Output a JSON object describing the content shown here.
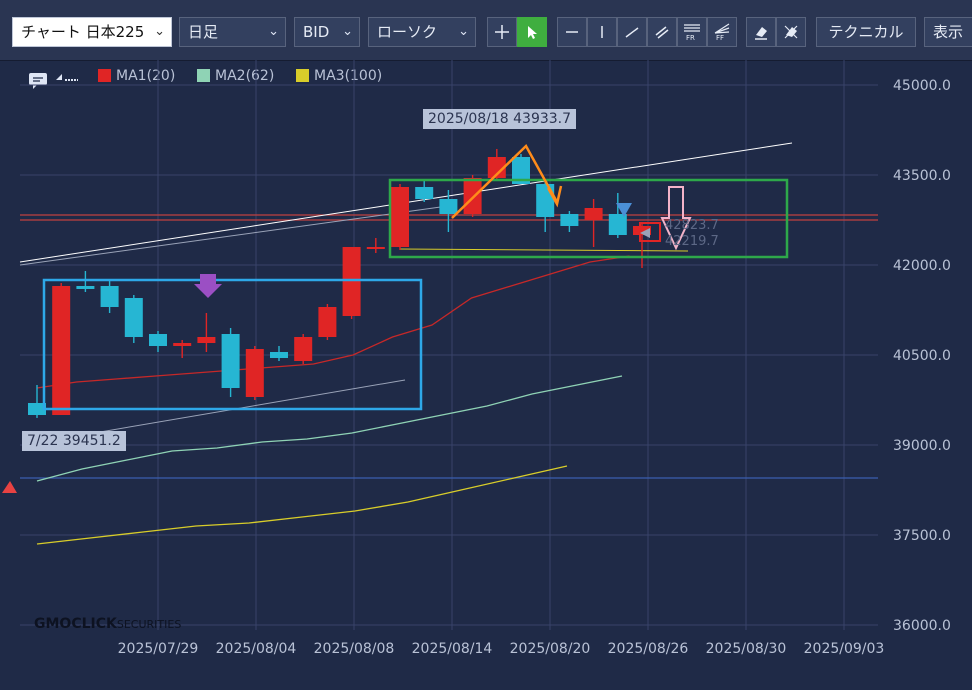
{
  "toolbar": {
    "symbol": "チャート 日本225",
    "timeframe": "日足",
    "price_type": "BID",
    "chart_style": "ローソク",
    "technical_label": "テクニカル",
    "display_label": "表示",
    "fr_label": "FR",
    "ff_label": "FF"
  },
  "legend": {
    "ma1": "MA1(20)",
    "ma2": "MA2(62)",
    "ma3": "MA3(100)"
  },
  "colors": {
    "ma1": "#c62828",
    "ma2": "#8fd3b5",
    "ma3": "#d8cd2a",
    "up": "#e02525",
    "down": "#26b6d3",
    "background": "#1f2a47"
  },
  "annotations": {
    "high_tag": "2025/08/18 43933.7",
    "low_tag": "7/22 39451.2",
    "price_label_1": "42823.7",
    "price_label_2": "42219.7"
  },
  "branding": {
    "logo_main": "GMOCLICK",
    "logo_sub": "SECURITIES"
  },
  "chart_data": {
    "type": "candlestick",
    "y_ticks": [
      "45000.0",
      "43500.0",
      "42000.0",
      "40500.0",
      "39000.0",
      "37500.0",
      "36000.0"
    ],
    "ylim": [
      35750,
      45400
    ],
    "x_ticks": [
      "2025/07/29",
      "2025/08/04",
      "2025/08/08",
      "2025/08/14",
      "2025/08/20",
      "2025/08/26",
      "2025/08/30",
      "2025/09/03"
    ],
    "candles": [
      {
        "date": "2025/07/22",
        "open": 39700,
        "high": 40000,
        "low": 39451,
        "close": 39500
      },
      {
        "date": "2025/07/23",
        "open": 39500,
        "high": 41700,
        "low": 39500,
        "close": 41650
      },
      {
        "date": "2025/07/24",
        "open": 41650,
        "high": 41900,
        "low": 41550,
        "close": 41600
      },
      {
        "date": "2025/07/25",
        "open": 41650,
        "high": 41750,
        "low": 41200,
        "close": 41300
      },
      {
        "date": "2025/07/28",
        "open": 41450,
        "high": 41500,
        "low": 40700,
        "close": 40800
      },
      {
        "date": "2025/07/29",
        "open": 40850,
        "high": 40900,
        "low": 40550,
        "close": 40650
      },
      {
        "date": "2025/07/30",
        "open": 40650,
        "high": 40750,
        "low": 40450,
        "close": 40700
      },
      {
        "date": "2025/07/31",
        "open": 40700,
        "high": 41200,
        "low": 40550,
        "close": 40800
      },
      {
        "date": "2025/08/01",
        "open": 40850,
        "high": 40950,
        "low": 39800,
        "close": 39950
      },
      {
        "date": "2025/08/04",
        "open": 39800,
        "high": 40650,
        "low": 39750,
        "close": 40600
      },
      {
        "date": "2025/08/05",
        "open": 40550,
        "high": 40650,
        "low": 40400,
        "close": 40450
      },
      {
        "date": "2025/08/06",
        "open": 40400,
        "high": 40850,
        "low": 40350,
        "close": 40800
      },
      {
        "date": "2025/08/07",
        "open": 40800,
        "high": 41350,
        "low": 40750,
        "close": 41300
      },
      {
        "date": "2025/08/08",
        "open": 41150,
        "high": 42300,
        "low": 41100,
        "close": 42300
      },
      {
        "date": "2025/08/11",
        "open": 42300,
        "high": 42450,
        "low": 42200,
        "close": 42300
      },
      {
        "date": "2025/08/12",
        "open": 42300,
        "high": 43350,
        "low": 42250,
        "close": 43300
      },
      {
        "date": "2025/08/13",
        "open": 43300,
        "high": 43400,
        "low": 43050,
        "close": 43100
      },
      {
        "date": "2025/08/14",
        "open": 43100,
        "high": 43250,
        "low": 42550,
        "close": 42850
      },
      {
        "date": "2025/08/15",
        "open": 42850,
        "high": 43500,
        "low": 42800,
        "close": 43450
      },
      {
        "date": "2025/08/18",
        "open": 43450,
        "high": 43933.7,
        "low": 43400,
        "close": 43800
      },
      {
        "date": "2025/08/19",
        "open": 43800,
        "high": 43850,
        "low": 43350,
        "close": 43350
      },
      {
        "date": "2025/08/20",
        "open": 43350,
        "high": 43400,
        "low": 42550,
        "close": 42800
      },
      {
        "date": "2025/08/21",
        "open": 42850,
        "high": 42900,
        "low": 42550,
        "close": 42650
      },
      {
        "date": "2025/08/22",
        "open": 42750,
        "high": 43100,
        "low": 42300,
        "close": 42950
      },
      {
        "date": "2025/08/25",
        "open": 42850,
        "high": 43200,
        "low": 42450,
        "close": 42500
      },
      {
        "date": "2025/08/26",
        "open": 42500,
        "high": 42700,
        "low": 41950,
        "close": 42650
      }
    ],
    "series": [
      {
        "name": "MA1(20)",
        "values": [
          39950,
          40050,
          40100,
          40150,
          40200,
          40250,
          40300,
          40350,
          40500,
          40800,
          41000,
          41450,
          41650,
          41850,
          42050,
          42150
        ]
      },
      {
        "name": "MA2(62)",
        "values": [
          38400,
          38600,
          38750,
          38900,
          38950,
          39050,
          39100,
          39200,
          39350,
          39500,
          39650,
          39850,
          40000,
          40150
        ]
      },
      {
        "name": "MA3(100)",
        "values": [
          37350,
          37450,
          37550,
          37650,
          37700,
          37800,
          37900,
          38050,
          38250,
          38450,
          38650
        ]
      }
    ],
    "grid": true
  }
}
